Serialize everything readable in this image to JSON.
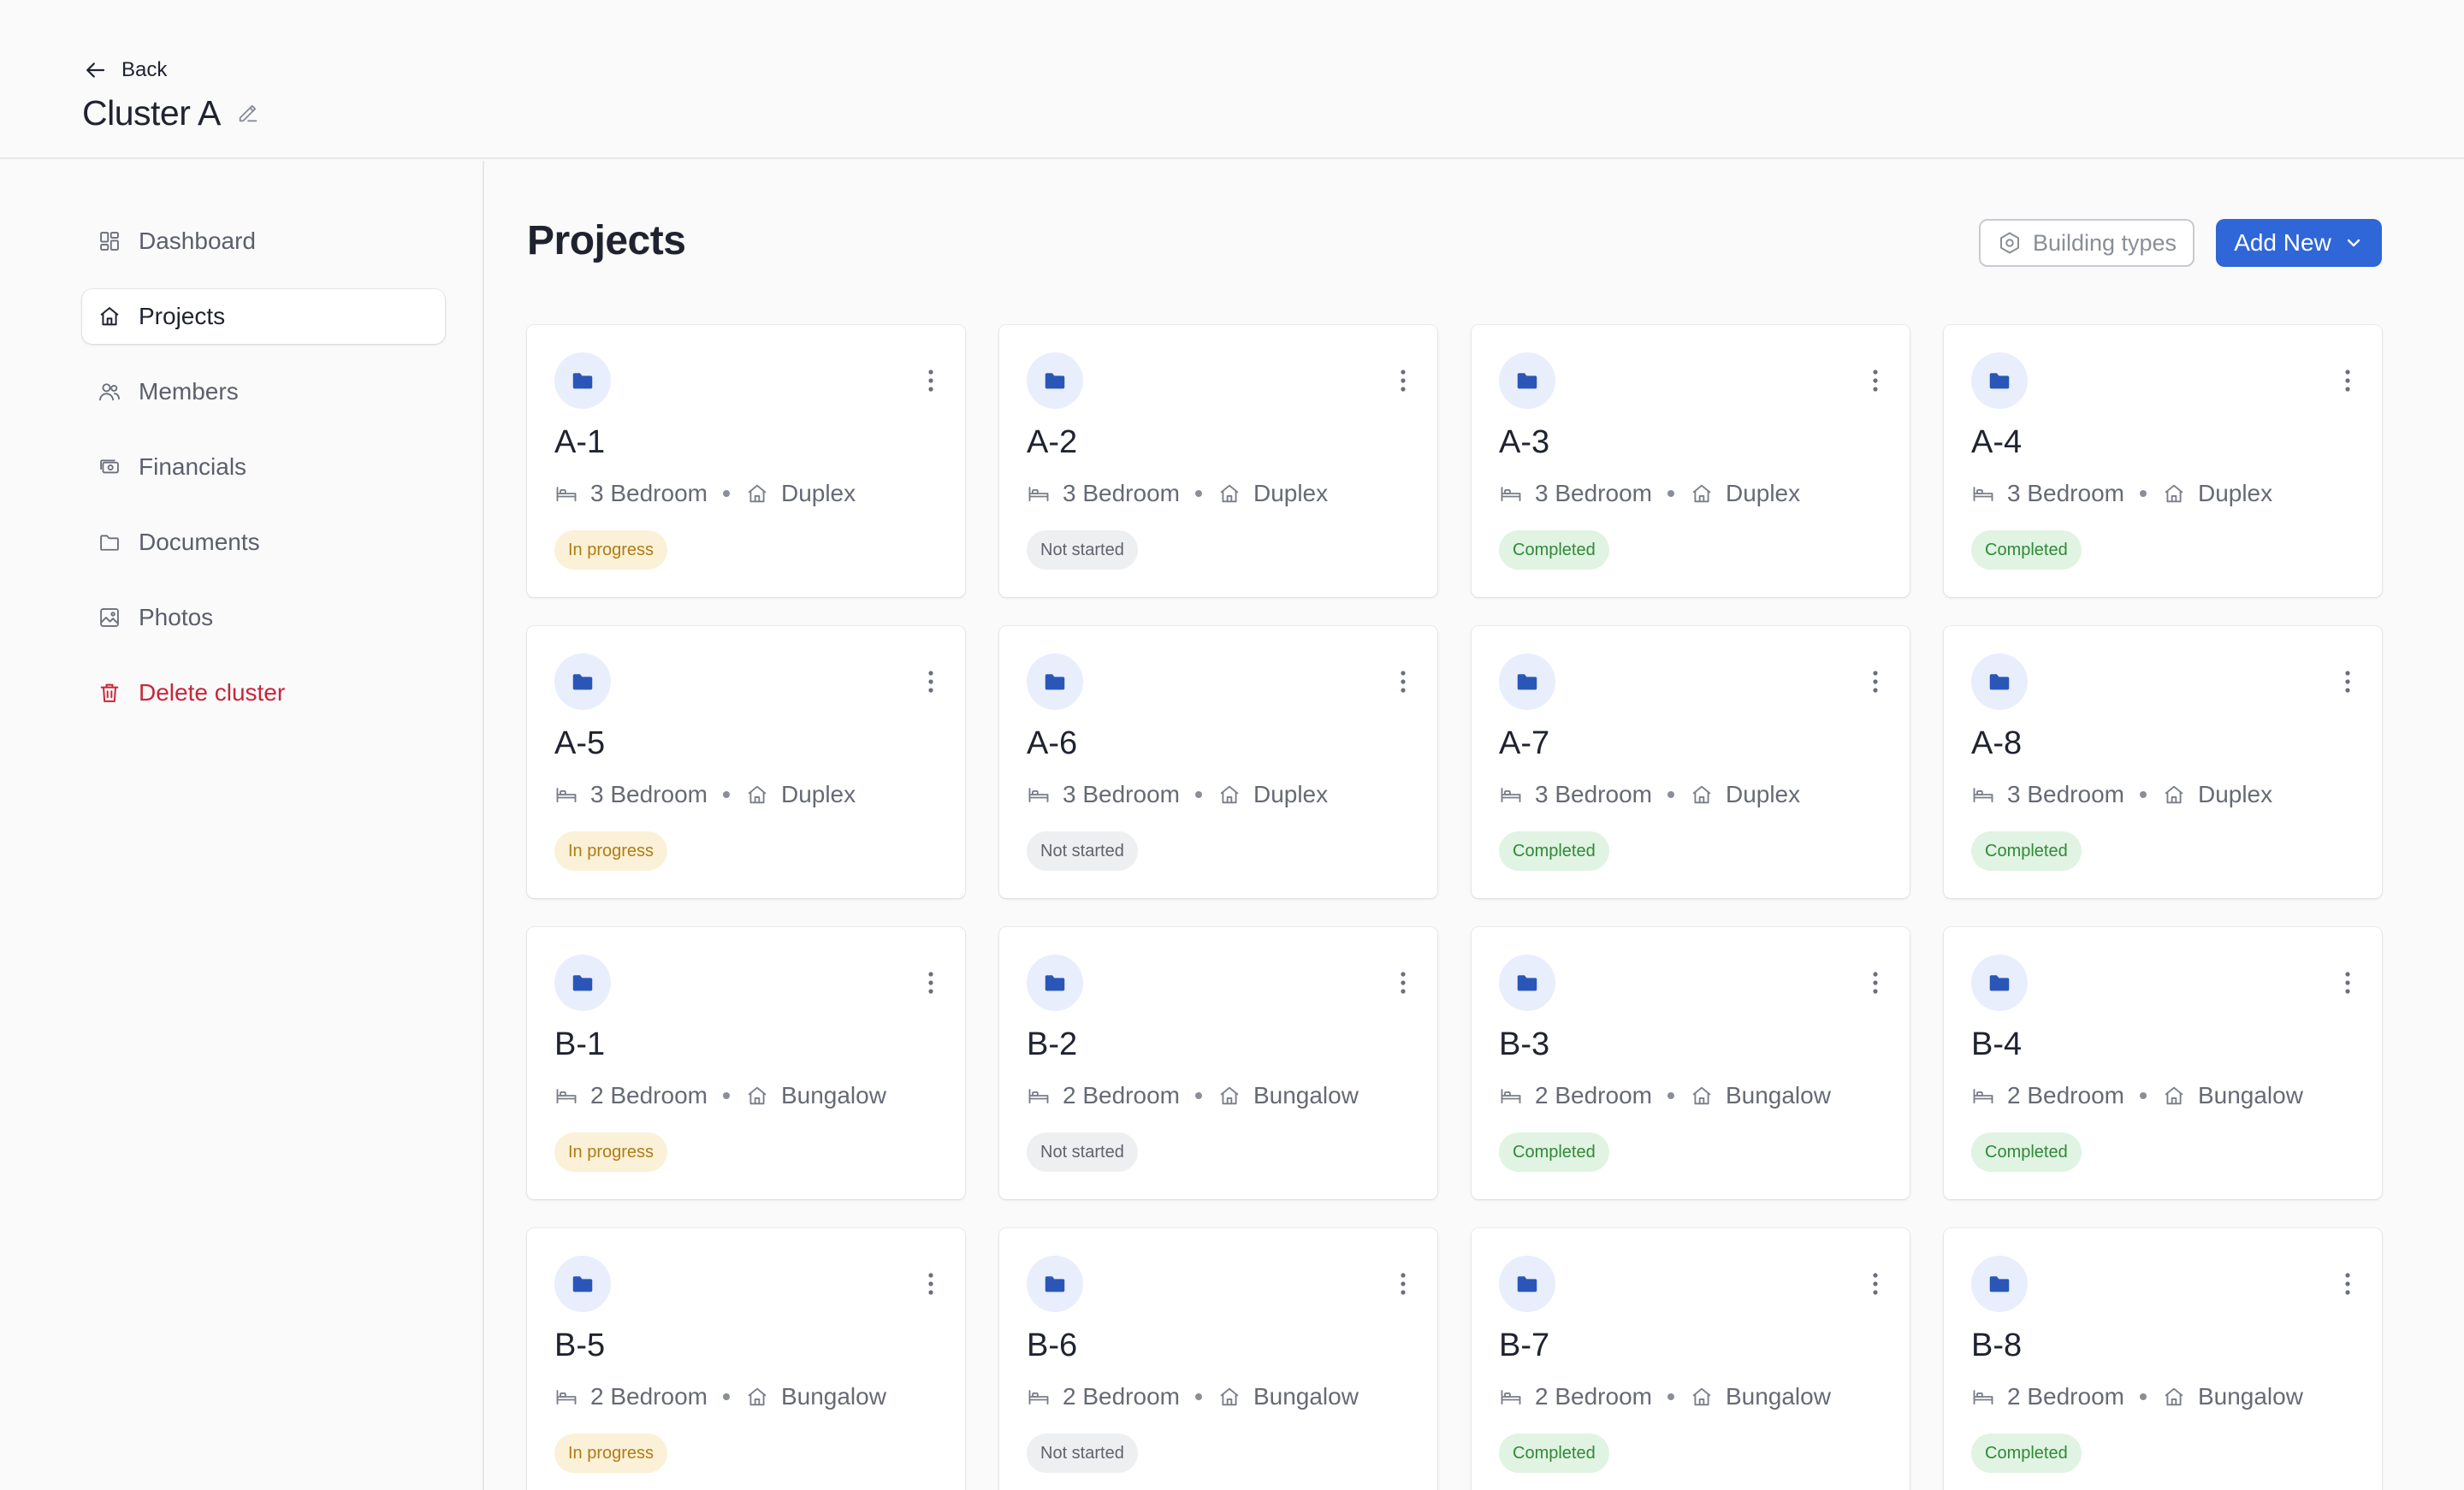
{
  "header": {
    "back_label": "Back",
    "title": "Cluster A"
  },
  "sidebar": {
    "items": [
      {
        "label": "Dashboard",
        "icon": "dashboard-icon",
        "active": false
      },
      {
        "label": "Projects",
        "icon": "home-icon",
        "active": true
      },
      {
        "label": "Members",
        "icon": "users-icon",
        "active": false
      },
      {
        "label": "Financials",
        "icon": "cash-icon",
        "active": false
      },
      {
        "label": "Documents",
        "icon": "folder-icon",
        "active": false
      },
      {
        "label": "Photos",
        "icon": "image-icon",
        "active": false
      },
      {
        "label": "Delete cluster",
        "icon": "trash-icon",
        "active": false,
        "danger": true
      }
    ]
  },
  "main": {
    "title": "Projects",
    "building_types_label": "Building types",
    "add_new_label": "Add New"
  },
  "colors": {
    "accent": "#2f66d8",
    "danger": "#c8263b",
    "status_in_progress_bg": "#fbf1d8",
    "status_in_progress_text": "#b07b12",
    "status_not_started_bg": "#eeeff1",
    "status_not_started_text": "#5f636d",
    "status_completed_bg": "#e1f3e2",
    "status_completed_text": "#2f8a38"
  },
  "projects": [
    {
      "name": "A-1",
      "bedrooms": "3 Bedroom",
      "type": "Duplex",
      "status": "In progress"
    },
    {
      "name": "A-2",
      "bedrooms": "3 Bedroom",
      "type": "Duplex",
      "status": "Not started"
    },
    {
      "name": "A-3",
      "bedrooms": "3 Bedroom",
      "type": "Duplex",
      "status": "Completed"
    },
    {
      "name": "A-4",
      "bedrooms": "3 Bedroom",
      "type": "Duplex",
      "status": "Completed"
    },
    {
      "name": "A-5",
      "bedrooms": "3 Bedroom",
      "type": "Duplex",
      "status": "In progress"
    },
    {
      "name": "A-6",
      "bedrooms": "3 Bedroom",
      "type": "Duplex",
      "status": "Not started"
    },
    {
      "name": "A-7",
      "bedrooms": "3 Bedroom",
      "type": "Duplex",
      "status": "Completed"
    },
    {
      "name": "A-8",
      "bedrooms": "3 Bedroom",
      "type": "Duplex",
      "status": "Completed"
    },
    {
      "name": "B-1",
      "bedrooms": "2 Bedroom",
      "type": "Bungalow",
      "status": "In progress"
    },
    {
      "name": "B-2",
      "bedrooms": "2 Bedroom",
      "type": "Bungalow",
      "status": "Not started"
    },
    {
      "name": "B-3",
      "bedrooms": "2 Bedroom",
      "type": "Bungalow",
      "status": "Completed"
    },
    {
      "name": "B-4",
      "bedrooms": "2 Bedroom",
      "type": "Bungalow",
      "status": "Completed"
    },
    {
      "name": "B-5",
      "bedrooms": "2 Bedroom",
      "type": "Bungalow",
      "status": "In progress"
    },
    {
      "name": "B-6",
      "bedrooms": "2 Bedroom",
      "type": "Bungalow",
      "status": "Not started"
    },
    {
      "name": "B-7",
      "bedrooms": "2 Bedroom",
      "type": "Bungalow",
      "status": "Completed"
    },
    {
      "name": "B-8",
      "bedrooms": "2 Bedroom",
      "type": "Bungalow",
      "status": "Completed"
    }
  ]
}
